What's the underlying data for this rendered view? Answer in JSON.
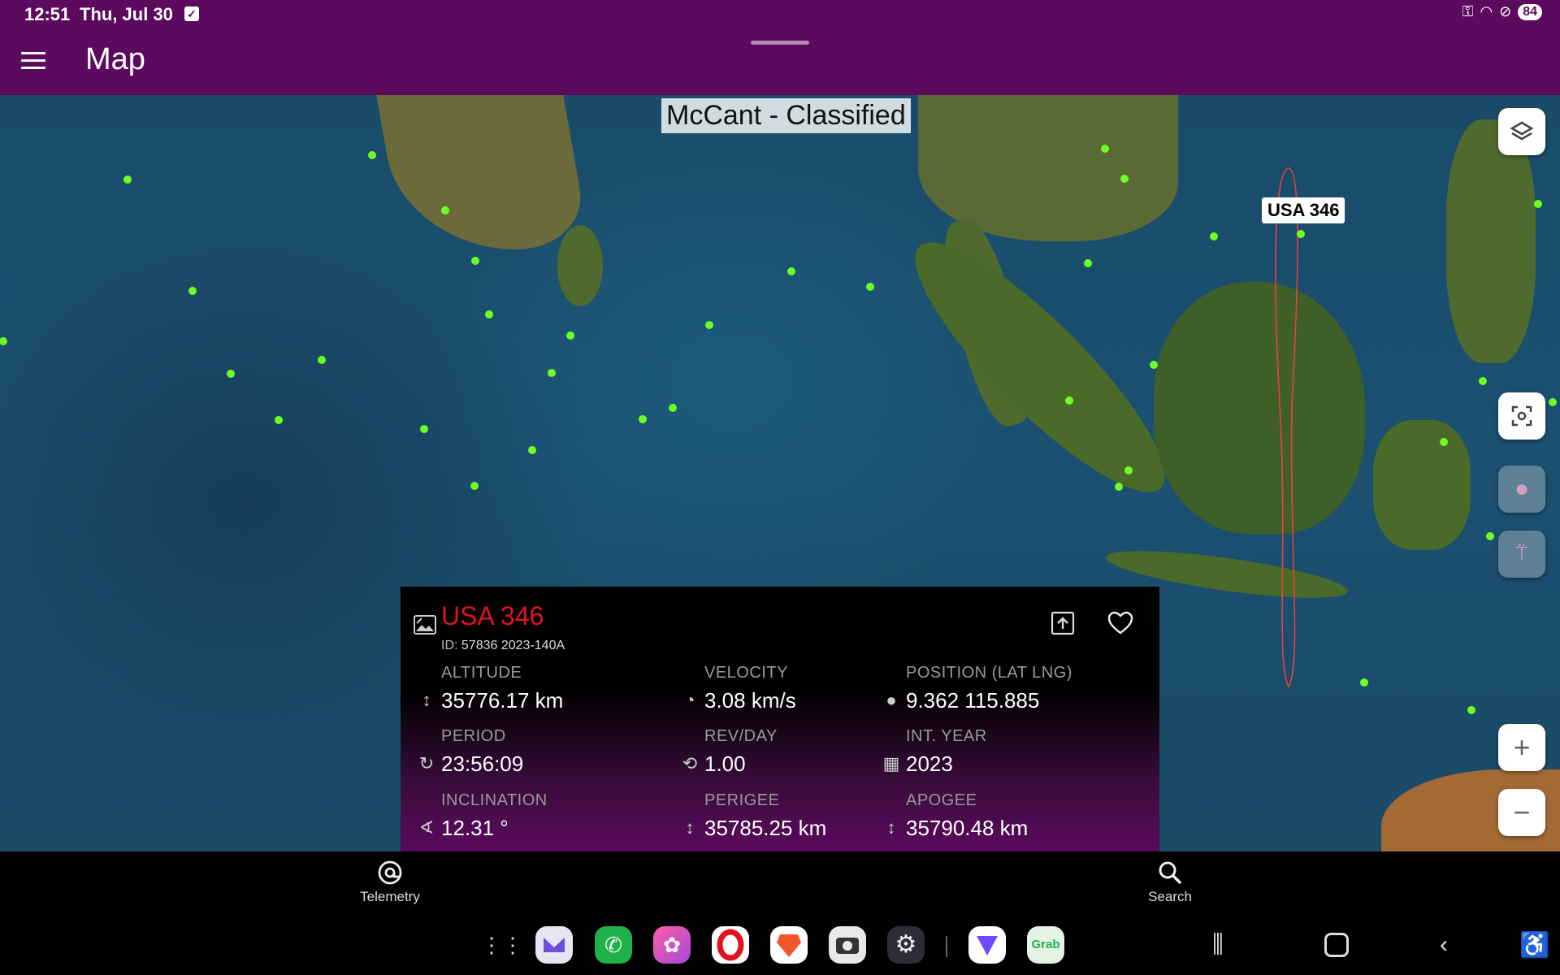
{
  "status_bar": {
    "time": "12:51",
    "date": "Thu, Jul 30",
    "battery": "84"
  },
  "app_bar": {
    "title": "Map"
  },
  "map": {
    "source_label": "McCant - Classified",
    "satellite_label": "USA 346",
    "dot_color": "#6dff24",
    "orbit_color": "#e8413b"
  },
  "info_panel": {
    "name": "USA 346",
    "id_prefix": "ID:",
    "id_value": "57836 2023-140A",
    "stats": {
      "altitude": {
        "label": "ALTITUDE",
        "value": "35776.17 km"
      },
      "velocity": {
        "label": "VELOCITY",
        "value": "3.08 km/s"
      },
      "position": {
        "label": "POSITION (LAT LNG)",
        "value": "9.362 115.885"
      },
      "period": {
        "label": "PERIOD",
        "value": "23:56:09"
      },
      "rev_day": {
        "label": "REV/DAY",
        "value": "1.00"
      },
      "int_year": {
        "label": "INT. YEAR",
        "value": "2023"
      },
      "inclination": {
        "label": "INCLINATION",
        "value": "12.31 °"
      },
      "perigee": {
        "label": "PERIGEE",
        "value": "35785.25 km"
      },
      "apogee": {
        "label": "APOGEE",
        "value": "35790.48 km"
      }
    },
    "name_color": "#e0131f"
  },
  "bottom_nav": {
    "telemetry": "Telemetry",
    "search": "Search"
  },
  "dock": {
    "apps": [
      "app-drawer",
      "email",
      "phone",
      "gallery",
      "opera",
      "brave",
      "camera",
      "settings",
      "proton-vpn",
      "grab"
    ],
    "grab_label": "Grab"
  }
}
